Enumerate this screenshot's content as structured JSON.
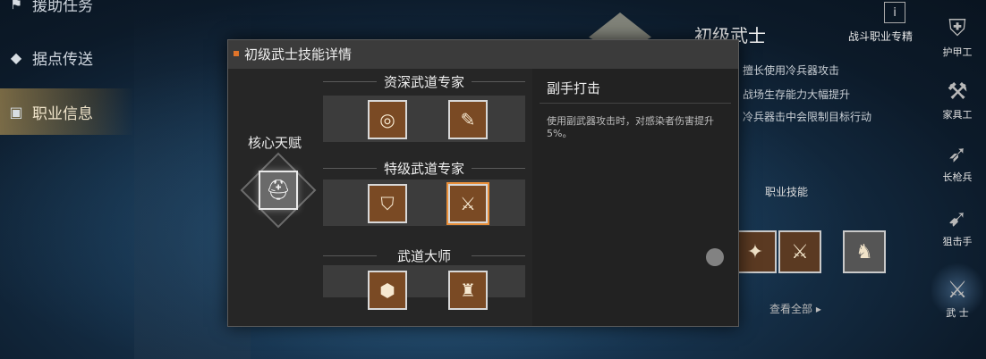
{
  "left_nav": {
    "items": [
      {
        "label": "援助任务",
        "icon": "flag-icon"
      },
      {
        "label": "据点传送",
        "icon": "compass-icon"
      },
      {
        "label": "职业信息",
        "icon": "profile-icon"
      }
    ]
  },
  "right_panel": {
    "title": "初级武士",
    "subtitle": "战斗职业专精",
    "info_icon": "i",
    "lines": [
      "擅长使用冷兵器攻击",
      "战场生存能力大幅提升",
      "冷兵器击中会限制目标行动"
    ],
    "skills_label": "职业技能",
    "view_all": "查看全部 ▸"
  },
  "career_list": [
    {
      "label": "护甲工"
    },
    {
      "label": "家具工"
    },
    {
      "label": "长枪兵"
    },
    {
      "label": "狙击手"
    },
    {
      "label": "武 士"
    }
  ],
  "dialog": {
    "title": "初级武士技能详情",
    "core_label": "核心天赋",
    "tiers": [
      {
        "name": "资深武道专家"
      },
      {
        "name": "特级武道专家"
      },
      {
        "name": "武道大师"
      }
    ],
    "detail": {
      "title": "副手打击",
      "description": "使用副武器攻击时，对感染者伤害提升5%。"
    }
  },
  "colors": {
    "accent": "#e0742a",
    "skill_bg": "#7a4a24",
    "panel": "#262626"
  }
}
